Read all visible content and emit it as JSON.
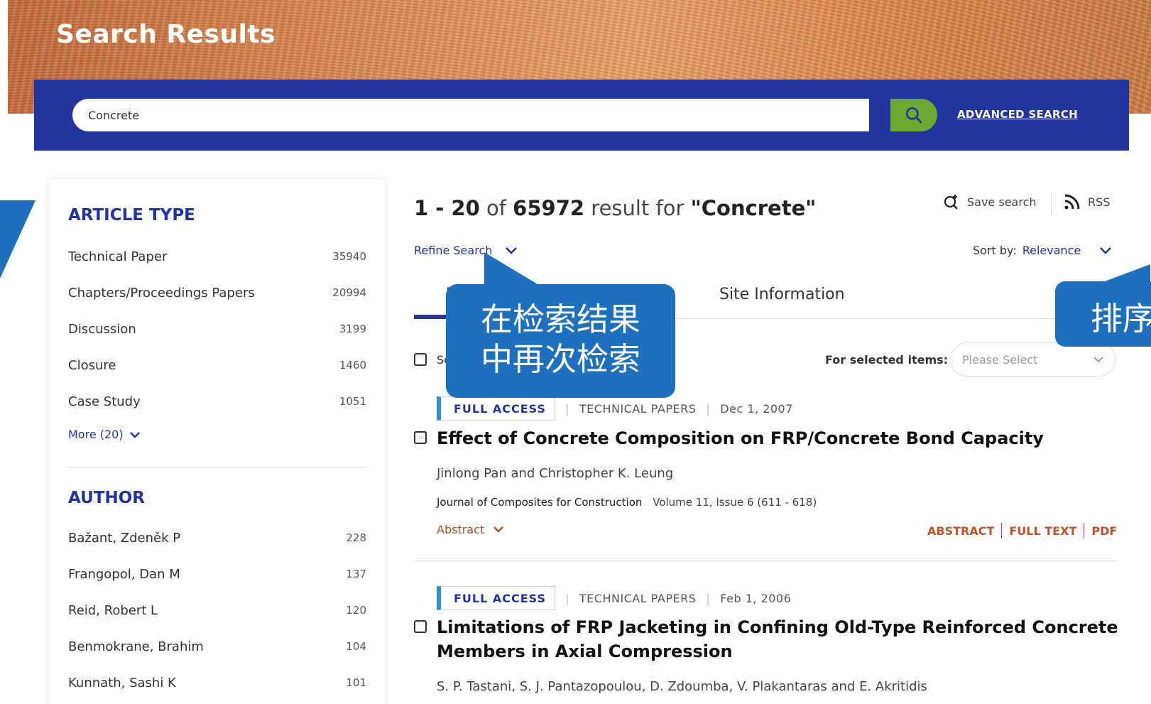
{
  "hero": {
    "title": "Search Results"
  },
  "search": {
    "query": "Concrete",
    "advanced_label": "ADVANCED SEARCH"
  },
  "filters": {
    "article_type": {
      "heading": "ARTICLE TYPE",
      "items": [
        {
          "label": "Technical Paper",
          "count": "35940"
        },
        {
          "label": "Chapters/Proceedings Papers",
          "count": "20994"
        },
        {
          "label": "Discussion",
          "count": "3199"
        },
        {
          "label": "Closure",
          "count": "1460"
        },
        {
          "label": "Case Study",
          "count": "1051"
        }
      ],
      "more_label": "More (20)"
    },
    "author": {
      "heading": "AUTHOR",
      "items": [
        {
          "label": "Bažant, Zdeněk P",
          "count": "228"
        },
        {
          "label": "Frangopol, Dan M",
          "count": "137"
        },
        {
          "label": "Reid, Robert L",
          "count": "120"
        },
        {
          "label": "Benmokrane, Brahim",
          "count": "104"
        },
        {
          "label": "Kunnath, Sashi K",
          "count": "101"
        }
      ]
    }
  },
  "results": {
    "range": "1 - 20",
    "of_word": "of",
    "total": "65972",
    "result_for": "result for",
    "query_quoted": "\"Concrete\"",
    "save_search_label": "Save search",
    "rss_label": "RSS",
    "refine_label": "Refine Search",
    "sort_label": "Sort by:",
    "sort_value": "Relevance",
    "tab_partial": "P",
    "tab_site": "Site Information",
    "select_all_partial": "Se",
    "for_selected_label": "For selected items:",
    "please_select": "Please Select",
    "items": [
      {
        "access": "FULL ACCESS",
        "type": "TECHNICAL PAPERS",
        "date": "Dec 1, 2007",
        "title": "Effect of Concrete Composition on FRP/Concrete Bond Capacity",
        "authors": "Jinlong Pan and Christopher K. Leung",
        "journal": "Journal of Composites for Construction",
        "volume": "Volume 11, Issue 6 (611 - 618)",
        "abstract_toggle": "Abstract",
        "links": [
          "ABSTRACT",
          "FULL TEXT",
          "PDF"
        ]
      },
      {
        "access": "FULL ACCESS",
        "type": "TECHNICAL PAPERS",
        "date": "Feb 1, 2006",
        "title": "Limitations of FRP Jacketing in Confining Old-Type Reinforced Concrete Members in Axial Compression",
        "authors": "S. P. Tastani, S. J. Pantazopoulou, D. Zdoumba, V. Plakantaras and E. Akritidis"
      }
    ]
  },
  "annotations": {
    "refine_callout": [
      "在检索结果",
      "中再次检索"
    ],
    "sort_callout": "排序"
  },
  "colors": {
    "brand_blue": "#22349e",
    "search_green": "#6aaa2f",
    "callout_blue": "#1f6fbf",
    "link_orange": "#c0502a"
  }
}
